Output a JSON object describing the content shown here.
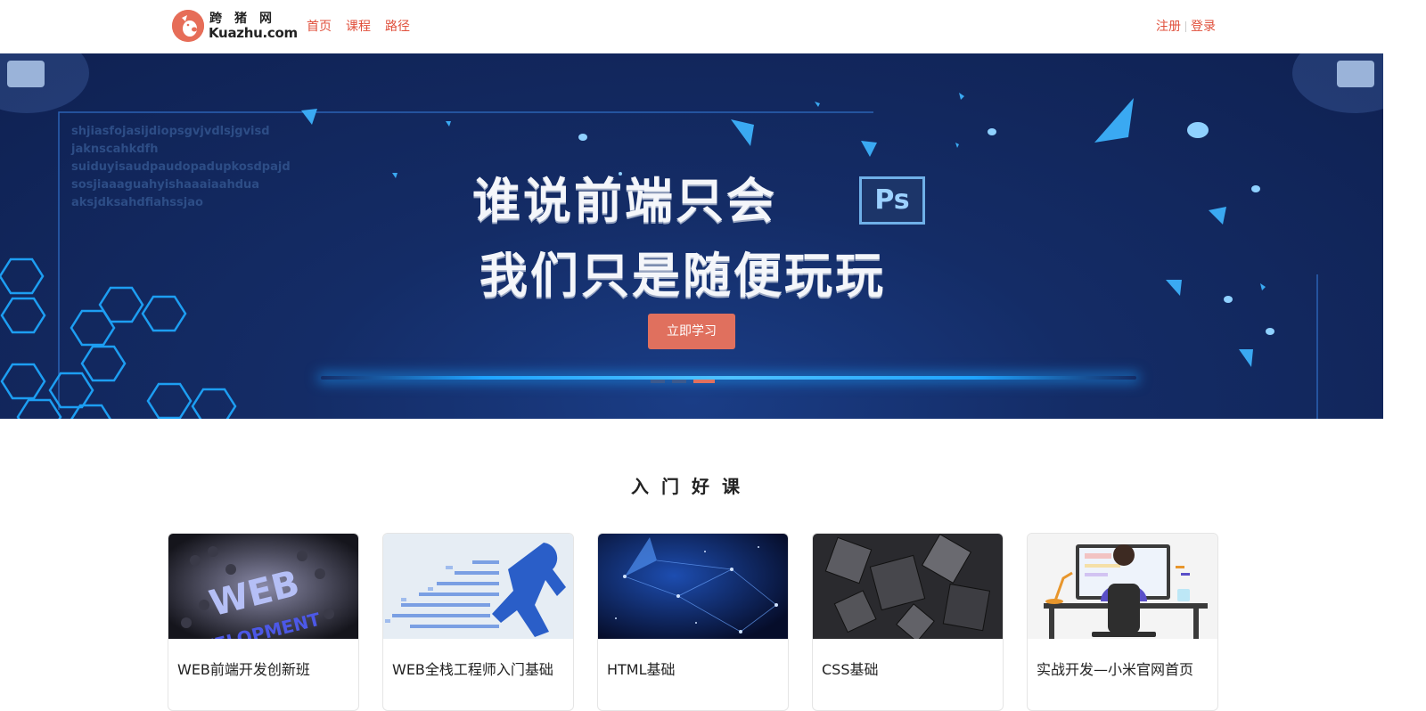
{
  "header": {
    "logo": {
      "cn": "跨猪网",
      "en": "Kuazhu.com"
    },
    "nav": [
      "首页",
      "课程",
      "路径"
    ],
    "auth": {
      "register": "注册",
      "login": "登录"
    }
  },
  "banner": {
    "code_lines": [
      "shjiasfojasijdiopsgvjvdlsjgvisd",
      "jaknscahkdfh",
      "suiduyisaudpaudopadupkosdpajd",
      "sosjiaaaguahyishaaaiaahdua",
      "aksjdksahdfiahssjao"
    ],
    "headline_line1": "谁说前端只会",
    "ps_badge": "Ps",
    "headline_line2": "我们只是随便玩玩",
    "cta_label": "立即学习",
    "carousel": {
      "count": 3,
      "active": 3
    }
  },
  "section": {
    "title": "入门好课",
    "courses": [
      {
        "title": "WEB前端开发创新班",
        "thumb": "web-development"
      },
      {
        "title": "WEB全栈工程师入门基础",
        "thumb": "pixel-runner"
      },
      {
        "title": "HTML基础",
        "thumb": "blue-network"
      },
      {
        "title": "CSS基础",
        "thumb": "dark-cubes"
      },
      {
        "title": "实战开发—小米官网首页",
        "thumb": "developer-desk"
      }
    ]
  },
  "colors": {
    "accent": "#e0503c",
    "button": "#e0705e",
    "banner_bg": "#142c66"
  }
}
